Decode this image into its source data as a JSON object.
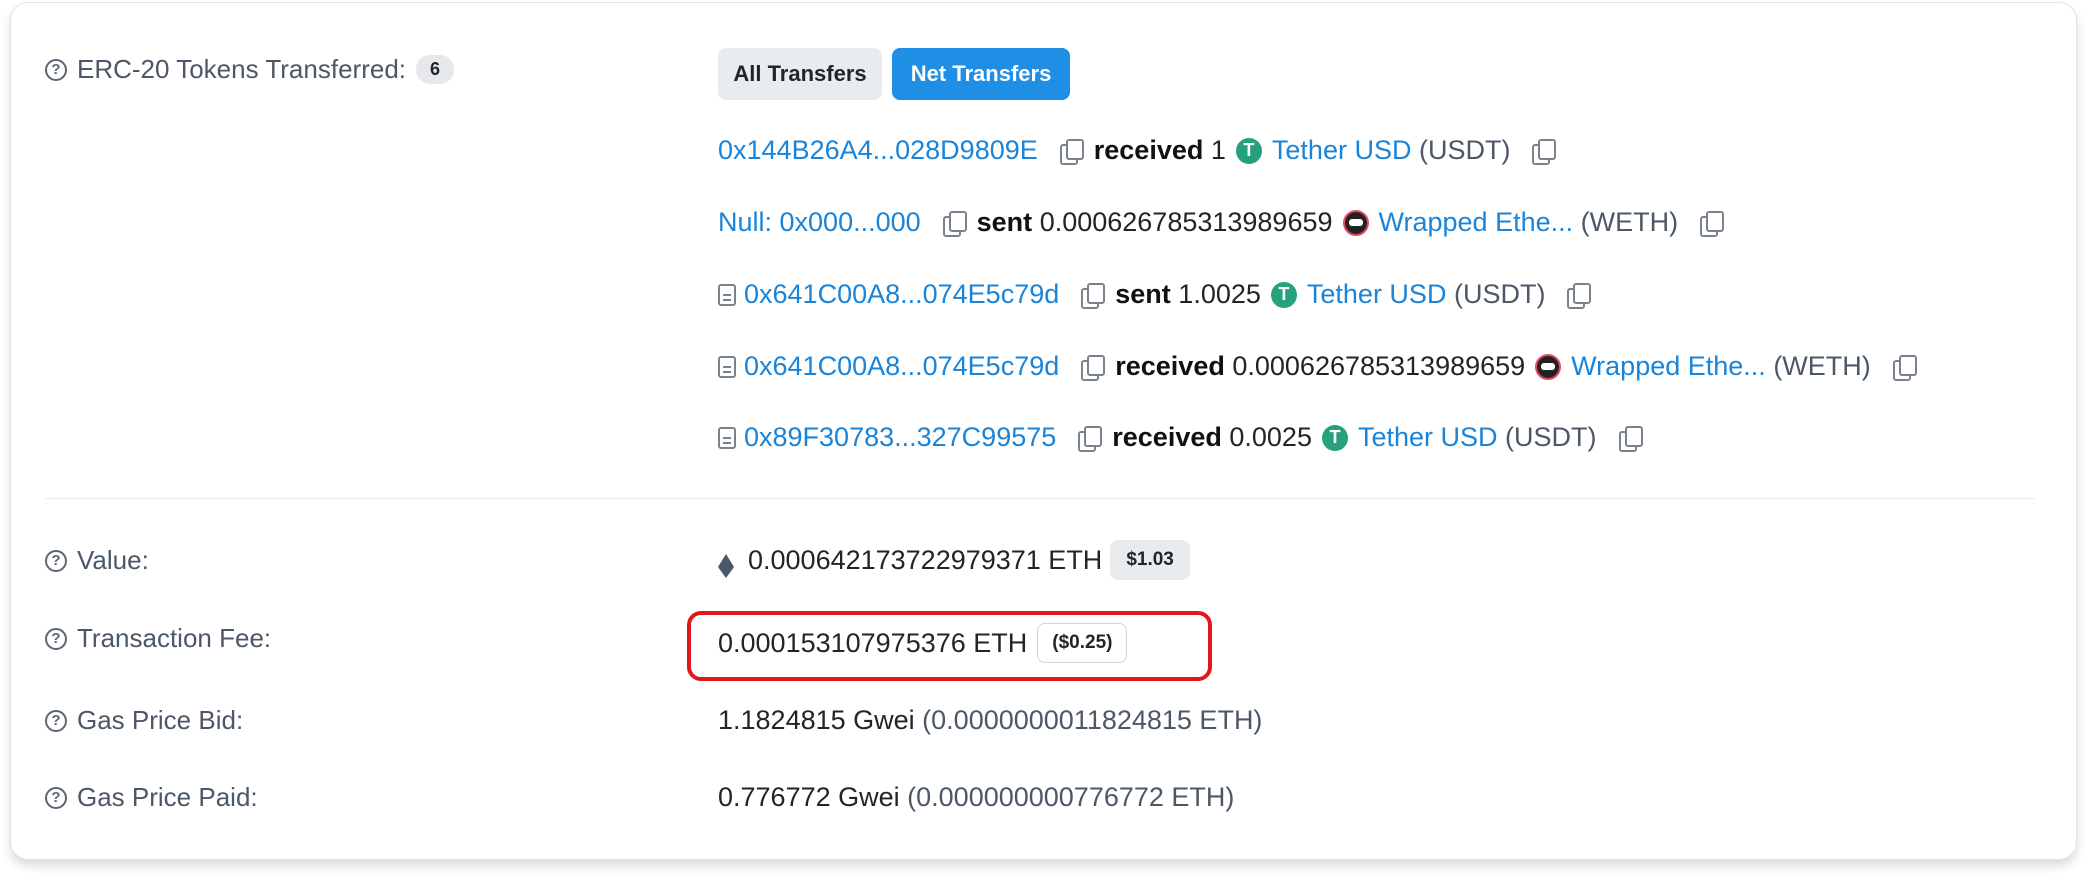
{
  "erc20": {
    "label": "ERC-20 Tokens Transferred:",
    "count": "6",
    "tabs": [
      "All Transfers",
      "Net Transfers"
    ],
    "transfers": [
      {
        "address": "0x144B26A4...028D9809E",
        "contract": false,
        "action": "received",
        "amount": "1",
        "token_icon": "tether-icon",
        "token_name": "Tether USD",
        "symbol": "(USDT)"
      },
      {
        "address": "Null: 0x000...000",
        "contract": false,
        "action": "sent",
        "amount": "0.000626785313989659",
        "token_icon": "weth-icon",
        "token_name": "Wrapped Ethe...",
        "symbol": "(WETH)"
      },
      {
        "address": "0x641C00A8...074E5c79d",
        "contract": true,
        "action": "sent",
        "amount": "1.0025",
        "token_icon": "tether-icon",
        "token_name": "Tether USD",
        "symbol": "(USDT)"
      },
      {
        "address": "0x641C00A8...074E5c79d",
        "contract": true,
        "action": "received",
        "amount": "0.000626785313989659",
        "token_icon": "weth-icon",
        "token_name": "Wrapped Ethe...",
        "symbol": "(WETH)"
      },
      {
        "address": "0x89F30783...327C99575",
        "contract": true,
        "action": "received",
        "amount": "0.0025",
        "token_icon": "tether-icon",
        "token_name": "Tether USD",
        "symbol": "(USDT)"
      }
    ]
  },
  "value": {
    "label": "Value:",
    "amount": "0.000642173722979371 ETH",
    "usd": "$1.03"
  },
  "fee": {
    "label": "Transaction Fee:",
    "amount": "0.000153107975376 ETH",
    "usd": "($0.25)"
  },
  "gas_bid": {
    "label": "Gas Price Bid:",
    "gwei": "1.1824815 Gwei",
    "eth": "(0.0000000011824815 ETH)"
  },
  "gas_paid": {
    "label": "Gas Price Paid:",
    "gwei": "0.776772 Gwei",
    "eth": "(0.000000000776772 ETH)"
  },
  "colors": {
    "link": "#1a84d8",
    "accent": "#1f8fe6",
    "highlight": "#e01818",
    "tether": "#26a17b"
  }
}
